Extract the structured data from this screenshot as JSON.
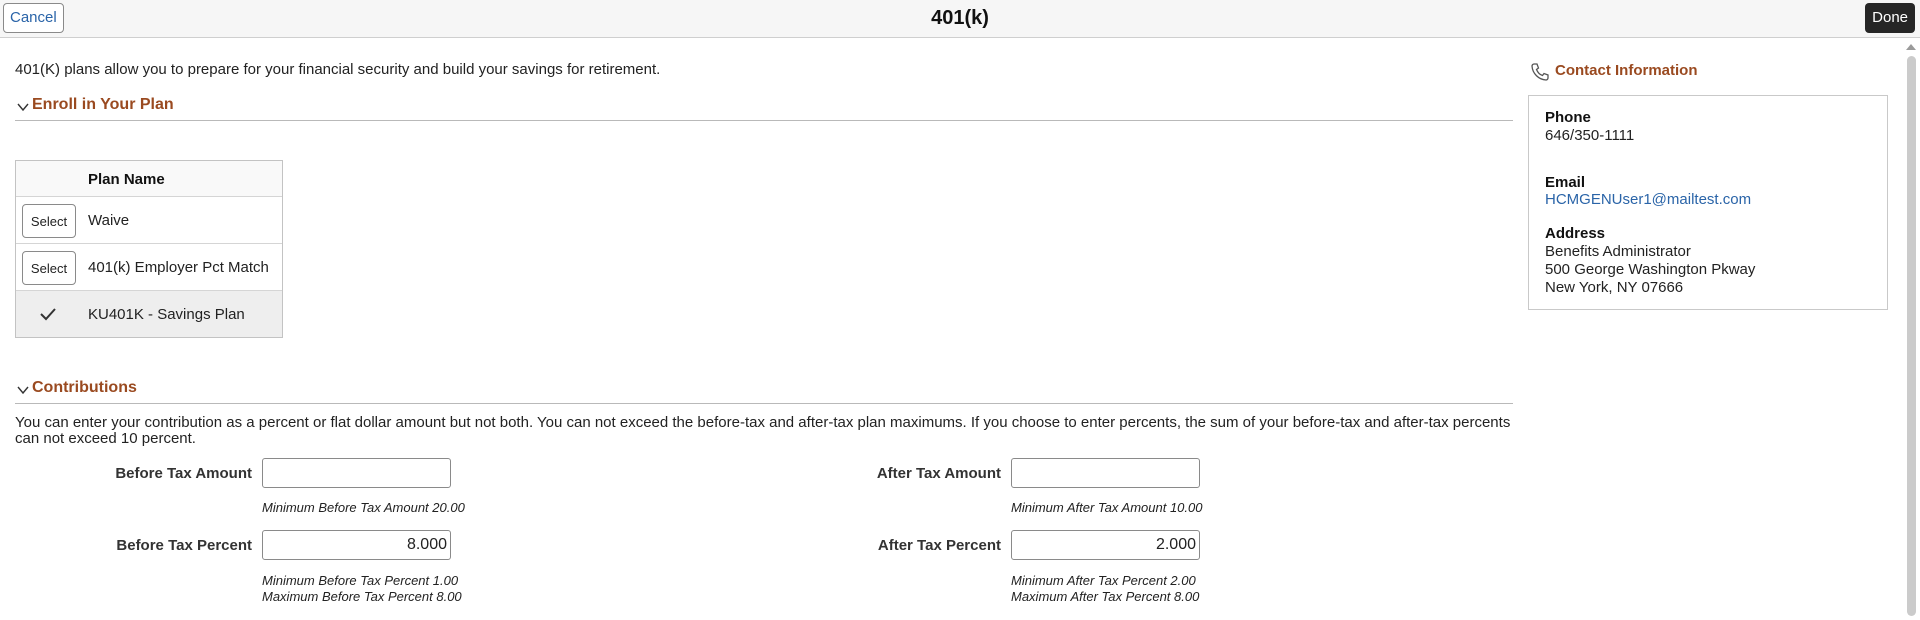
{
  "header": {
    "title": "401(k)",
    "cancel_label": "Cancel",
    "done_label": "Done"
  },
  "intro": "401(K) plans allow you to prepare for your financial security and build your savings for retirement.",
  "enroll": {
    "title": "Enroll in Your Plan",
    "column_header": "Plan Name",
    "select_label": "Select",
    "plans": [
      {
        "name": "Waive",
        "selected": false
      },
      {
        "name": "401(k) Employer Pct Match",
        "selected": false
      },
      {
        "name": "KU401K - Savings Plan",
        "selected": true
      }
    ]
  },
  "contributions": {
    "title": "Contributions",
    "description": "You can enter your contribution as a percent or flat dollar amount but not both. You can not exceed the before-tax and after-tax plan maximums. If you choose to enter percents, the sum of your before-tax and after-tax percents can not exceed 10 percent.",
    "before_tax_amount": {
      "label": "Before Tax Amount",
      "value": "",
      "hint": "Minimum Before Tax Amount 20.00"
    },
    "after_tax_amount": {
      "label": "After Tax Amount",
      "value": "",
      "hint": "Minimum After Tax Amount 10.00"
    },
    "before_tax_percent": {
      "label": "Before Tax Percent",
      "value": "8.000",
      "hint_min": "Minimum Before Tax Percent 1.00",
      "hint_max": "Maximum Before Tax Percent 8.00"
    },
    "after_tax_percent": {
      "label": "After Tax Percent",
      "value": "2.000",
      "hint_min": "Minimum After Tax Percent 2.00",
      "hint_max": "Maximum After Tax Percent 8.00"
    }
  },
  "contact": {
    "title": "Contact Information",
    "phone_label": "Phone",
    "phone": "646/350-1111",
    "email_label": "Email",
    "email": "HCMGENUser1@mailtest.com",
    "address_label": "Address",
    "address_line1": "Benefits Administrator",
    "address_line2": "500 George Washington Pkway",
    "address_line3": "New York, NY 07666"
  },
  "colors": {
    "section_title": "#9a4a20",
    "link": "#2a64a8",
    "done_bg": "#262626"
  },
  "icons": [
    "chevron-down-icon",
    "checkmark-icon",
    "phone-icon"
  ]
}
